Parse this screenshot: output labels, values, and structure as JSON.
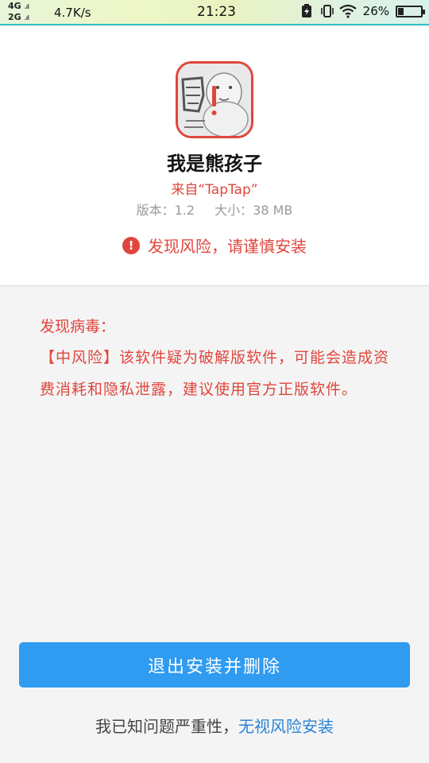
{
  "status_bar": {
    "network_top": "4G",
    "network_bottom": "2G",
    "speed": "4.7K/s",
    "time": "21:23",
    "battery_percent": "26%",
    "battery_level": 0.26,
    "icons": [
      "battery-saver-icon",
      "vibrate-icon",
      "wifi-icon"
    ]
  },
  "app": {
    "icon": "bear-meme-icon",
    "name": "我是熊孩子",
    "source": "来自“TapTap”",
    "version_label": "版本：1.2",
    "size_label": "大小：38 MB"
  },
  "warning": {
    "icon": "exclamation-icon",
    "text": "发现风险，请谨慎安装"
  },
  "virus": {
    "title": "发现病毒：",
    "description": "【中风险】该软件疑为破解版软件，可能会造成资费消耗和隐私泄露，建议使用官方正版软件。"
  },
  "actions": {
    "exit_button": "退出安装并删除",
    "ignore_prefix": "我已知问题严重性，",
    "ignore_link": "无视风险安装"
  },
  "colors": {
    "danger": "#e0463d",
    "primary": "#2f9bf1",
    "link": "#2a83d8"
  }
}
